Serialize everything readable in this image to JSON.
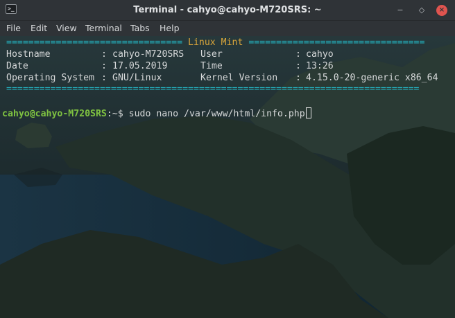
{
  "window": {
    "title": "Terminal - cahyo@cahyo-M720SRS: ~",
    "controls": {
      "minimize": "−",
      "maximize": "◇",
      "close": "×"
    }
  },
  "menu": [
    "File",
    "Edit",
    "View",
    "Terminal",
    "Tabs",
    "Help"
  ],
  "banner": {
    "sep_left": "================================",
    "title": " Linux Mint ",
    "sep_right": "================================",
    "rows": [
      {
        "label1": "Hostname",
        "value1": "cahyo-M720SRS",
        "label2": "User",
        "value2": "cahyo"
      },
      {
        "label1": "Date",
        "value1": "17.05.2019",
        "label2": "Time",
        "value2": "13:26"
      },
      {
        "label1": "Operating System",
        "value1": "GNU/Linux",
        "label2": "Kernel Version",
        "value2": "4.15.0-20-generic x86_64"
      }
    ],
    "sep_bottom": "==========================================================================="
  },
  "prompt": {
    "user_host": "cahyo@cahyo-M720SRS",
    "path_symbol": ":~$ ",
    "command": "sudo nano /var/www/html/info.php"
  },
  "colors": {
    "separator": "#24b5c3",
    "banner_title": "#d9a53a",
    "prompt_user": "#7fc241",
    "text": "#d7d9da",
    "close_button": "#e0544f"
  },
  "icons": {
    "app": "terminal-icon"
  }
}
